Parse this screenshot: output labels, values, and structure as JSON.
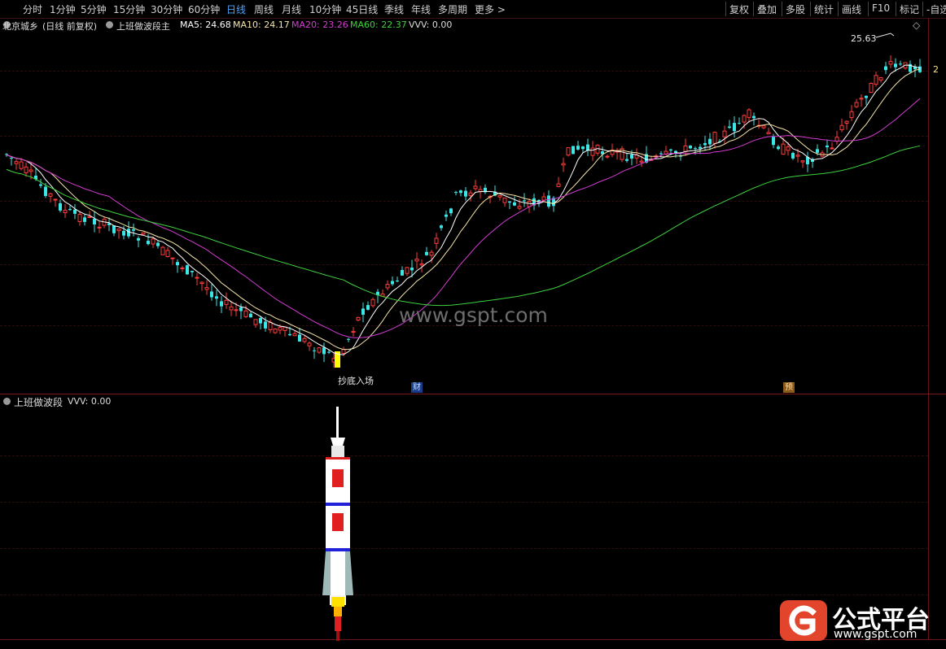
{
  "toolbar": {
    "left_items": [
      {
        "label": "分时",
        "active": false
      },
      {
        "label": "1分钟",
        "active": false
      },
      {
        "label": "5分钟",
        "active": false
      },
      {
        "label": "15分钟",
        "active": false
      },
      {
        "label": "30分钟",
        "active": false
      },
      {
        "label": "60分钟",
        "active": false
      },
      {
        "label": "日线",
        "active": true
      },
      {
        "label": "周线",
        "active": false
      },
      {
        "label": "月线",
        "active": false
      },
      {
        "label": "10分钟",
        "active": false
      },
      {
        "label": "45日线",
        "active": false
      },
      {
        "label": "季线",
        "active": false
      },
      {
        "label": "年线",
        "active": false
      },
      {
        "label": "多周期",
        "active": false
      },
      {
        "label": "更多",
        "active": false
      }
    ],
    "right_items": [
      "复权",
      "叠加",
      "多股",
      "统计",
      "画线",
      "F10",
      "标记",
      "-自选"
    ]
  },
  "main_info": {
    "stock": "北京城乡",
    "mode": "(日线 前复权)",
    "indicator": "上班做波段主",
    "ma5": "MA5: 24.68",
    "ma10": "MA10: 24.17",
    "ma20": "MA20: 23.26",
    "ma60": "MA60: 22.37",
    "vvv": "VVV: 0.00"
  },
  "sub_info": {
    "indicator": "上班做波段",
    "vvv": "VVV: 0.00"
  },
  "annotations": {
    "high_price": "25.63",
    "bottom_label": "抄底入场",
    "cai_marker": "财",
    "yu_marker": "预",
    "right_edge_price": "2"
  },
  "watermark": "www.gspt.com",
  "brand": {
    "title": "公式平台",
    "url": "www.gspt.com"
  },
  "colors": {
    "up": "#ff3b3b",
    "down": "#3ce6e6",
    "ma5": "#ffffff",
    "ma10": "#f5e6a8",
    "ma20": "#d23cd2",
    "ma60": "#3fd23f",
    "accent": "#4aa3ff"
  }
}
